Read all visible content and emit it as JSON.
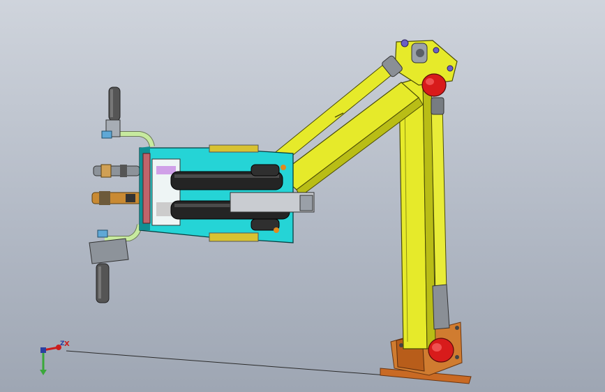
{
  "viewport": {
    "background_top": "#cfd4dc",
    "background_bottom": "#9ea6b3"
  },
  "triad": {
    "x_label": "X",
    "z_label": "Z",
    "x_color": "#cc1d1d",
    "y_color": "#3aa83a",
    "z_color": "#2b3fa0"
  },
  "model": {
    "colors": {
      "arm": "#e6ea2a",
      "arm_shadow": "#b9bd16",
      "arm_dark": "#8e9110",
      "gripper_body": "#25d4d6",
      "gripper_dark": "#0f8f93",
      "cylinder": "#242424",
      "cap_red": "#d81b1b",
      "base_plate": "#c96a24",
      "pipe": "#c7ea9f",
      "handle": "#555555",
      "purple_bolt": "#6c60c4"
    },
    "icons": [
      "pneumatic-balancer-arm-model",
      "coordinate-triad-icon"
    ]
  }
}
